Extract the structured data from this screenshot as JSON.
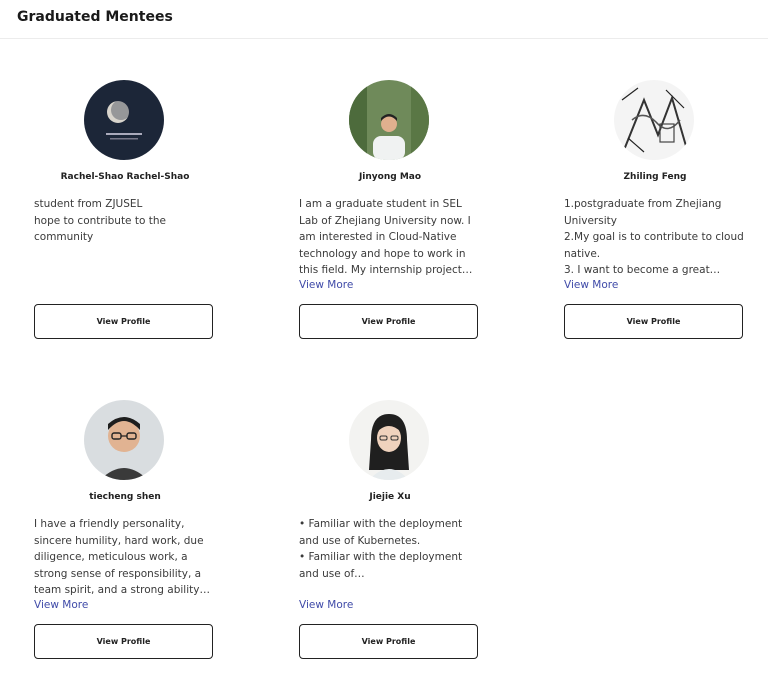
{
  "header": {
    "title": "Graduated Mentees"
  },
  "mentees": [
    {
      "name": "Rachel-Shao Rachel-Shao",
      "description": "student from ZJUSEL\nhope to contribute to the community",
      "view_more": "",
      "button": "View Profile",
      "avatar_icon": "moon-avatar-icon"
    },
    {
      "name": "Jinyong Mao",
      "description": "I am a graduate student in SEL Lab of Zhejiang University now. I am interested in Cloud-Native technology and hope to work in this field. My internship project…",
      "view_more": "View More",
      "button": "View Profile",
      "avatar_icon": "person-outdoor-avatar-icon"
    },
    {
      "name": "Zhiling Feng",
      "description": "1.postgraduate from Zhejiang University\n2.My goal is to contribute to cloud native.\n3. I want to become a great…",
      "view_more": "View More",
      "button": "View Profile",
      "avatar_icon": "sketch-avatar-icon"
    },
    {
      "name": "tiecheng shen",
      "description": "I have a friendly personality, sincere humility, hard work, due diligence, meticulous work, a strong sense of responsibility, a team spirit, and a strong ability…",
      "view_more": "View More",
      "button": "View Profile",
      "avatar_icon": "person-glasses-avatar-icon"
    },
    {
      "name": "Jiejie Xu",
      "description": "•     Familiar with the deployment and use of Kubernetes.\n•     Familiar with the deployment and use of…",
      "view_more": "View More",
      "button": "View Profile",
      "avatar_icon": "person-longhair-avatar-icon"
    }
  ]
}
